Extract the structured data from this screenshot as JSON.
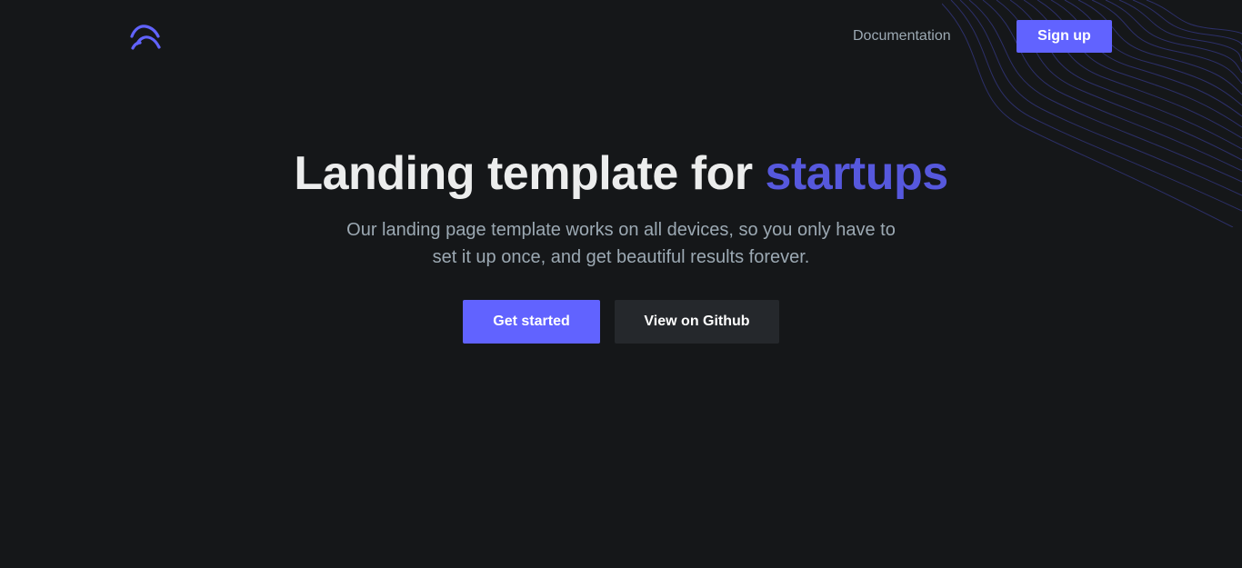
{
  "header": {
    "logo_icon": "logo-icon",
    "nav_link": "Documentation",
    "signup_label": "Sign up"
  },
  "hero": {
    "title_main": "Landing template for ",
    "title_accent": "startups",
    "subtitle": "Our landing page template works on all devices, so you only have to set it up once, and get beautiful results forever.",
    "primary_cta": "Get started",
    "secondary_cta": "View on Github"
  },
  "colors": {
    "background": "#151719",
    "accent": "#6163ff",
    "accent_text": "#5658dd",
    "heading": "#eceded",
    "muted_text": "#9ca9b3",
    "secondary_button": "#25282c"
  }
}
